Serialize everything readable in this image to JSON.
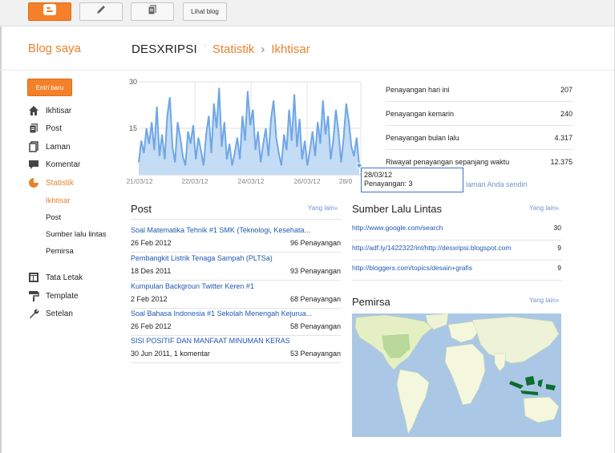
{
  "toolbar": {
    "blogger_icon": "blogger-logo-icon",
    "edit_icon": "pencil-icon",
    "pages_icon": "pages-icon",
    "view_blog_label": "Lihat blog"
  },
  "header": {
    "brand": "Blog saya",
    "blog_name": "DESXRIPSI",
    "dot": "·",
    "section": "Statistik",
    "separator": "›",
    "page": "Ikhtisar"
  },
  "sidebar": {
    "new_post_label": "Entri baru",
    "items": [
      {
        "label": "Ikhtisar",
        "icon": "home-icon"
      },
      {
        "label": "Post",
        "icon": "posts-icon"
      },
      {
        "label": "Laman",
        "icon": "page-icon"
      },
      {
        "label": "Komentar",
        "icon": "comment-icon"
      },
      {
        "label": "Statistik",
        "icon": "pie-chart-icon"
      }
    ],
    "stats_sub": [
      "Ikhtisar",
      "Post",
      "Sumber lalu lintas",
      "Pemirsa"
    ],
    "items_bottom": [
      {
        "label": "Tata Letak",
        "icon": "layout-icon"
      },
      {
        "label": "Template",
        "icon": "paint-roller-icon"
      },
      {
        "label": "Setelan",
        "icon": "wrench-icon"
      }
    ]
  },
  "chart_data": {
    "type": "area",
    "y_ticks": [
      "30",
      "15"
    ],
    "ylim": [
      0,
      30
    ],
    "x_tick_labels": [
      "21/03/12",
      "22/03/12",
      "24/03/12",
      "26/03/12",
      "28/0"
    ],
    "series": [
      {
        "color": "#6fa7e6",
        "values": [
          4,
          11,
          7,
          15,
          10,
          17,
          8,
          22,
          6,
          13,
          5,
          19,
          25,
          9,
          4,
          17,
          12,
          6,
          3,
          14,
          10,
          16,
          5,
          12,
          8,
          3,
          13,
          19,
          7,
          23,
          15,
          28,
          9,
          17,
          5,
          10,
          3,
          7,
          12,
          5,
          19,
          11,
          27,
          16,
          21,
          8,
          14,
          4,
          10,
          15,
          6,
          18,
          24,
          12,
          7,
          3,
          13,
          8,
          21,
          11,
          26,
          9,
          18,
          5,
          11,
          3,
          8,
          14,
          6,
          17,
          10,
          24,
          13,
          19,
          5,
          11,
          21,
          14,
          4,
          12,
          23,
          17,
          9,
          6,
          12,
          3
        ]
      }
    ]
  },
  "tooltip": {
    "date": "28/03/12",
    "views": "Penayangan: 3"
  },
  "hidden_link_fragment": "laman Anda sendiri",
  "stats": [
    {
      "label": "Penayangan hari ini",
      "value": "207"
    },
    {
      "label": "Penayangan kemarin",
      "value": "240"
    },
    {
      "label": "Penayangan bulan lalu",
      "value": "4.317"
    },
    {
      "label": "Riwayat penayangan sepanjang waktu",
      "value": "12.375"
    }
  ],
  "posts": {
    "title": "Post",
    "more": "Yang lain»",
    "items": [
      {
        "title": "Soal Matematika Tehnik #1 SMK (Teknologi, Kesehata...",
        "date": "26 Feb 2012",
        "views": "96 Penayangan"
      },
      {
        "title": "Pembangkit Listrik Tenaga Sampah (PLTSa)",
        "date": "18 Des 2011",
        "views": "93 Penayangan"
      },
      {
        "title": "Kumpulan Backgroun Twitter Keren #1",
        "date": "2 Feb 2012",
        "views": "68 Penayangan"
      },
      {
        "title": "Soal Bahasa Indonesia #1 Sekolah Menengah Kejurua...",
        "date": "26 Feb 2012",
        "views": "58 Penayangan"
      },
      {
        "title": "SISI POSITIF DAN MANFAAT MINUMAN KERAS",
        "date": "30 Jun 2011, 1 komentar",
        "views": "53 Penayangan"
      }
    ]
  },
  "sources": {
    "title": "Sumber Lalu Lintas",
    "more": "Yang lain»",
    "items": [
      {
        "url": "http://www.google.com/search",
        "count": "30"
      },
      {
        "url": "http://adf.ly/1422322/int/http://desxripsi.blogspot.com",
        "count": "9"
      },
      {
        "url": "http://bloggers.com/topics/desain+grafis",
        "count": "9"
      }
    ]
  },
  "audience": {
    "title": "Pemirsa",
    "more": "Yang lain»"
  },
  "colors": {
    "accent": "#e9822d",
    "link": "#1f59b0",
    "chart_line": "#6fa7e6",
    "chart_fill": "#c5dcf5",
    "map_water": "#aac8e6",
    "map_land": "#f4f7de",
    "map_highlight": "#0d6c2f"
  }
}
